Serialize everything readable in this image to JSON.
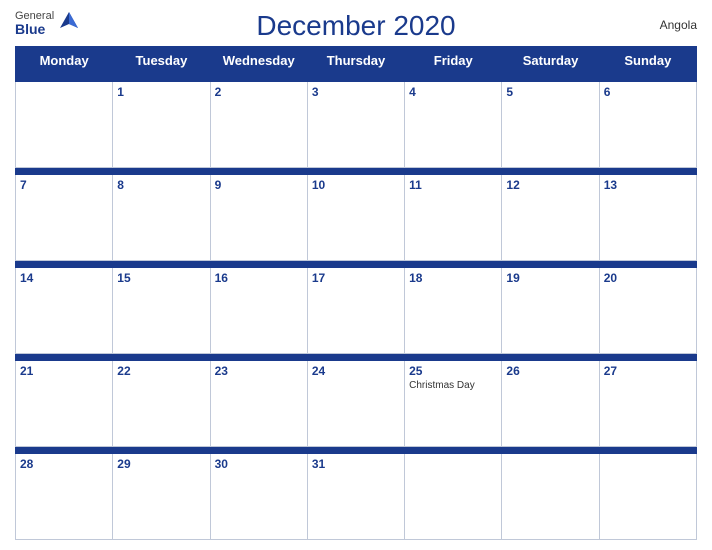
{
  "header": {
    "title": "December 2020",
    "country": "Angola",
    "logo_general": "General",
    "logo_blue": "Blue"
  },
  "weekdays": [
    "Monday",
    "Tuesday",
    "Wednesday",
    "Thursday",
    "Friday",
    "Saturday",
    "Sunday"
  ],
  "weeks": [
    [
      {
        "day": "",
        "empty": true
      },
      {
        "day": "1"
      },
      {
        "day": "2"
      },
      {
        "day": "3"
      },
      {
        "day": "4"
      },
      {
        "day": "5"
      },
      {
        "day": "6"
      }
    ],
    [
      {
        "day": "7"
      },
      {
        "day": "8"
      },
      {
        "day": "9"
      },
      {
        "day": "10"
      },
      {
        "day": "11"
      },
      {
        "day": "12"
      },
      {
        "day": "13"
      }
    ],
    [
      {
        "day": "14"
      },
      {
        "day": "15"
      },
      {
        "day": "16"
      },
      {
        "day": "17"
      },
      {
        "day": "18"
      },
      {
        "day": "19"
      },
      {
        "day": "20"
      }
    ],
    [
      {
        "day": "21"
      },
      {
        "day": "22"
      },
      {
        "day": "23"
      },
      {
        "day": "24"
      },
      {
        "day": "25",
        "event": "Christmas Day"
      },
      {
        "day": "26"
      },
      {
        "day": "27"
      }
    ],
    [
      {
        "day": "28"
      },
      {
        "day": "29"
      },
      {
        "day": "30"
      },
      {
        "day": "31"
      },
      {
        "day": "",
        "empty": true
      },
      {
        "day": "",
        "empty": true
      },
      {
        "day": "",
        "empty": true
      }
    ]
  ]
}
